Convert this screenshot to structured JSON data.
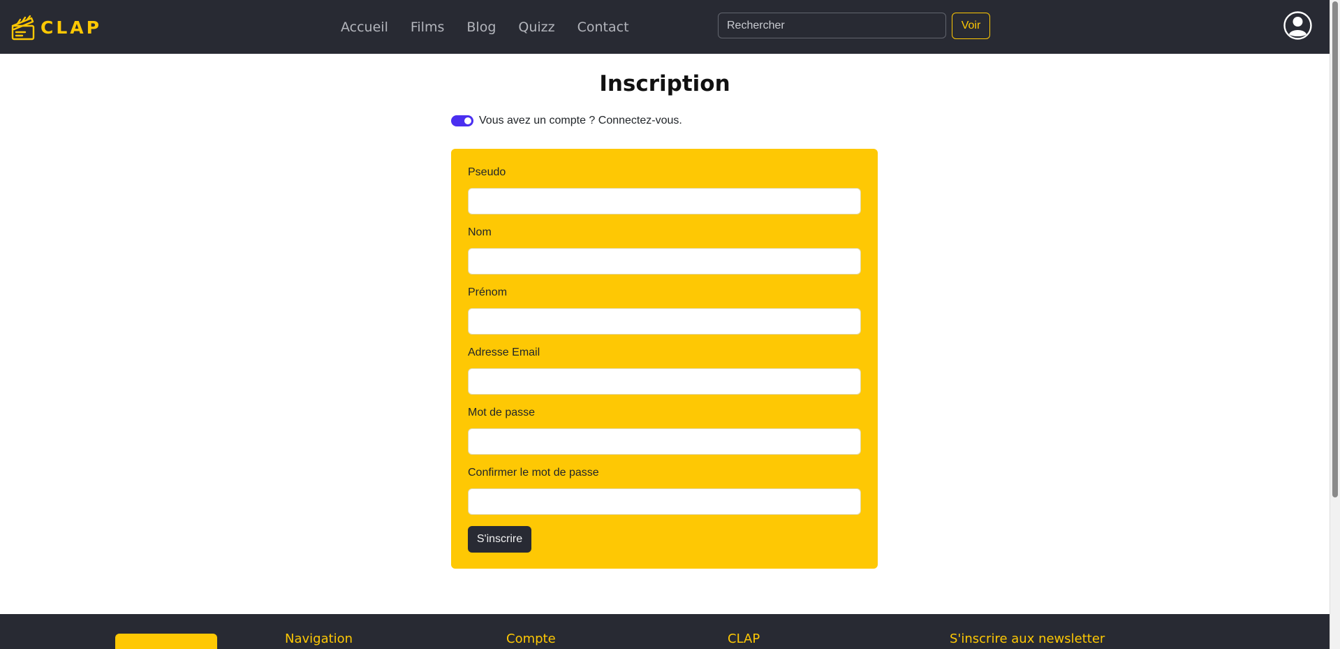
{
  "brand": {
    "name": "CLAP",
    "icon": "clapperboard-icon"
  },
  "nav": {
    "items": [
      {
        "label": "Accueil"
      },
      {
        "label": "Films"
      },
      {
        "label": "Blog"
      },
      {
        "label": "Quizz"
      },
      {
        "label": "Contact"
      }
    ]
  },
  "search": {
    "placeholder": "Rechercher",
    "button_label": "Voir"
  },
  "user": {
    "icon": "user-circle-icon"
  },
  "page": {
    "title": "Inscription"
  },
  "toggle": {
    "label": "Vous avez un compte ? Connectez-vous.",
    "checked": true
  },
  "form": {
    "fields": [
      {
        "label": "Pseudo",
        "value": ""
      },
      {
        "label": "Nom",
        "value": ""
      },
      {
        "label": "Prénom",
        "value": ""
      },
      {
        "label": "Adresse Email",
        "value": ""
      },
      {
        "label": "Mot de passe",
        "value": ""
      },
      {
        "label": "Confirmer le mot de passe",
        "value": ""
      }
    ],
    "submit_label": "S'inscrire"
  },
  "footer": {
    "headings": [
      {
        "label": "Navigation"
      },
      {
        "label": "Compte"
      },
      {
        "label": "CLAP"
      },
      {
        "label": "S'inscrire aux newsletter"
      }
    ]
  },
  "colors": {
    "accent": "#fec804",
    "dark": "#282a33",
    "toggle": "#4a2ff0"
  }
}
